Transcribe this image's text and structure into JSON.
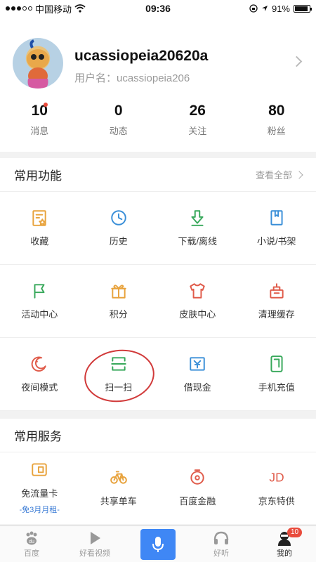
{
  "status_bar": {
    "carrier": "中国移动",
    "time": "09:36",
    "battery": "91%",
    "battery_level": 0.91
  },
  "profile": {
    "username": "ucassiopeia20620a",
    "subname": "用户名：ucassiopeia206",
    "stats": [
      {
        "num": "10",
        "label": "消息",
        "has_dot": true
      },
      {
        "num": "0",
        "label": "动态"
      },
      {
        "num": "26",
        "label": "关注"
      },
      {
        "num": "80",
        "label": "粉丝"
      }
    ]
  },
  "common_functions": {
    "title": "常用功能",
    "view_all": "查看全部",
    "items": [
      {
        "label": "收藏",
        "icon": "bookmark-star-icon",
        "color": "#e8a33d"
      },
      {
        "label": "历史",
        "icon": "clock-icon",
        "color": "#3a8fd8"
      },
      {
        "label": "下载/离线",
        "icon": "download-icon",
        "color": "#37a85a"
      },
      {
        "label": "小说/书架",
        "icon": "book-icon",
        "color": "#3a8fd8"
      },
      {
        "label": "活动中心",
        "icon": "flag-icon",
        "color": "#37a85a"
      },
      {
        "label": "积分",
        "icon": "gift-icon",
        "color": "#e8a33d"
      },
      {
        "label": "皮肤中心",
        "icon": "shirt-icon",
        "color": "#e05b4a"
      },
      {
        "label": "清理缓存",
        "icon": "clean-icon",
        "color": "#e05b4a"
      },
      {
        "label": "夜间模式",
        "icon": "moon-icon",
        "color": "#e05b4a"
      },
      {
        "label": "扫一扫",
        "icon": "scan-icon",
        "color": "#37a85a"
      },
      {
        "label": "借现金",
        "icon": "cash-icon",
        "color": "#3a8fd8"
      },
      {
        "label": "手机充值",
        "icon": "phone-recharge-icon",
        "color": "#37a85a"
      }
    ]
  },
  "common_services": {
    "title": "常用服务",
    "items": [
      {
        "label": "免流量卡",
        "sub": "-免3月月租-",
        "icon": "sim-card-icon",
        "color": "#e8a33d"
      },
      {
        "label": "共享单车",
        "sub": "",
        "icon": "bicycle-icon",
        "color": "#e8a33d"
      },
      {
        "label": "百度金融",
        "sub": "",
        "icon": "finance-icon",
        "color": "#e05b4a"
      },
      {
        "label": "京东特供",
        "sub": "",
        "icon": "jd-icon",
        "color": "#e05b4a",
        "glyph": "JD"
      }
    ]
  },
  "tabbar": {
    "tabs": [
      {
        "label": "百度",
        "icon": "paw-icon"
      },
      {
        "label": "好看视频",
        "icon": "play-icon"
      },
      {
        "label": "",
        "icon": "mic-icon"
      },
      {
        "label": "好听",
        "icon": "headphones-icon"
      },
      {
        "label": "我的",
        "icon": "person-icon",
        "badge": "10"
      }
    ]
  }
}
